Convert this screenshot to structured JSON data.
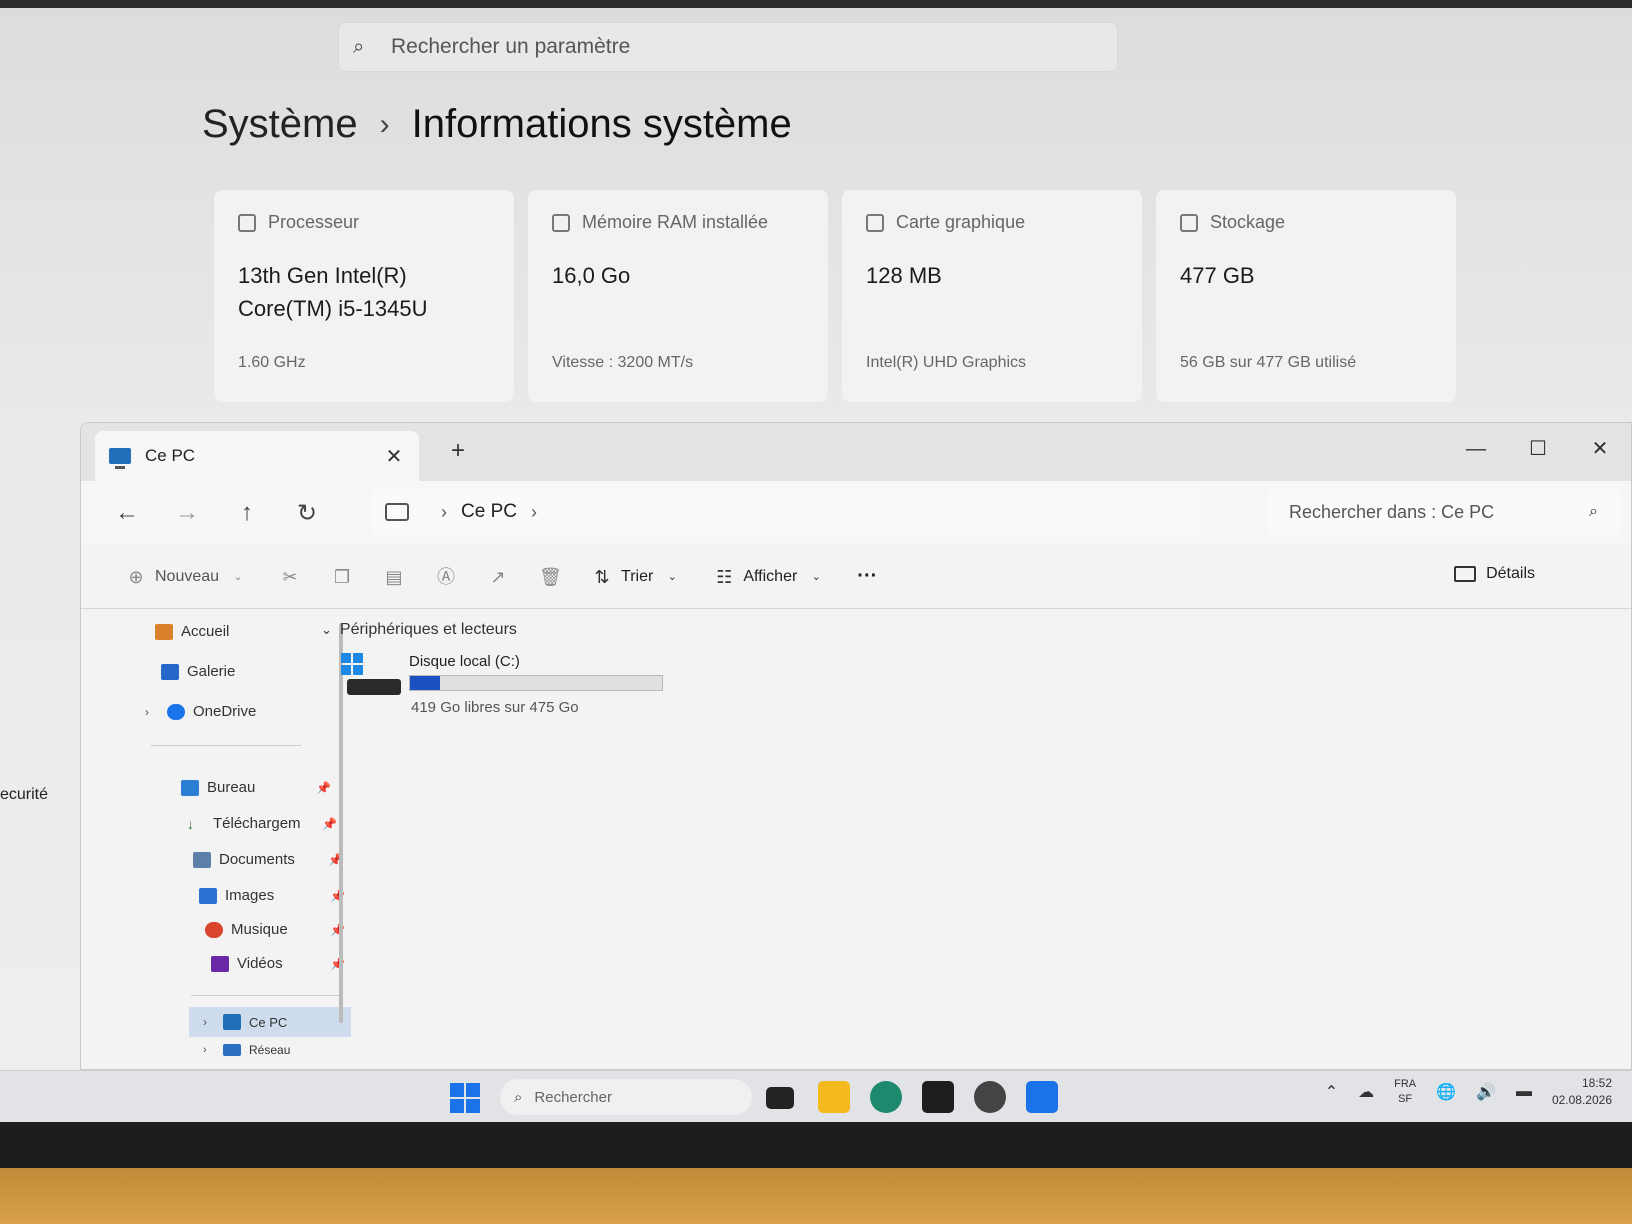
{
  "settings": {
    "search_placeholder": "Rechercher un paramètre",
    "breadcrumb": {
      "parent": "Système",
      "separator": "›",
      "current": "Informations système"
    },
    "left_partial_label": "ecurité",
    "cards": [
      {
        "title": "Processeur",
        "value_line1": "13th Gen Intel(R)",
        "value_line2": "Core(TM) i5-1345U",
        "sub": "1.60 GHz"
      },
      {
        "title": "Mémoire RAM installée",
        "value_line1": "16,0 Go",
        "value_line2": "",
        "sub": "Vitesse : 3200 MT/s"
      },
      {
        "title": "Carte graphique",
        "value_line1": "128 MB",
        "value_line2": "",
        "sub": "Intel(R) UHD Graphics"
      },
      {
        "title": "Stockage",
        "value_line1": "477 GB",
        "value_line2": "",
        "sub": "56 GB sur 477 GB utilisé"
      }
    ]
  },
  "explorer": {
    "tab": {
      "label": "Ce PC",
      "close": "✕"
    },
    "new_tab": "+",
    "window_controls": {
      "minimize": "—",
      "maximize": "☐",
      "close": "✕"
    },
    "nav": {
      "back": "←",
      "forward": "→",
      "up": "↑",
      "refresh": "↻"
    },
    "address": {
      "location": "Ce PC",
      "chev": "›"
    },
    "search_placeholder": "Rechercher dans : Ce PC",
    "commands": {
      "new": "Nouveau",
      "sort": "Trier",
      "view": "Afficher",
      "more": "···",
      "details": "Détails"
    },
    "sidebar": {
      "home": "Accueil",
      "gallery": "Galerie",
      "onedrive": "OneDrive",
      "pinned": [
        "Bureau",
        "Téléchargem",
        "Documents",
        "Images",
        "Musique",
        "Vidéos"
      ],
      "this_pc": "Ce PC",
      "network": "Réseau"
    },
    "group_header": "Périphériques et lecteurs",
    "drive": {
      "name": "Disque local (C:)",
      "free_text": "419 Go libres sur 475 Go",
      "used_fraction": 0.118
    }
  },
  "taskbar": {
    "search_placeholder": "Rechercher",
    "lang_line1": "FRA",
    "lang_line2": "SF",
    "time": "18:52",
    "date": "02.08.2026"
  },
  "colors": {
    "accent": "#1b4fc2",
    "windows_blue": "#1a73e8"
  }
}
